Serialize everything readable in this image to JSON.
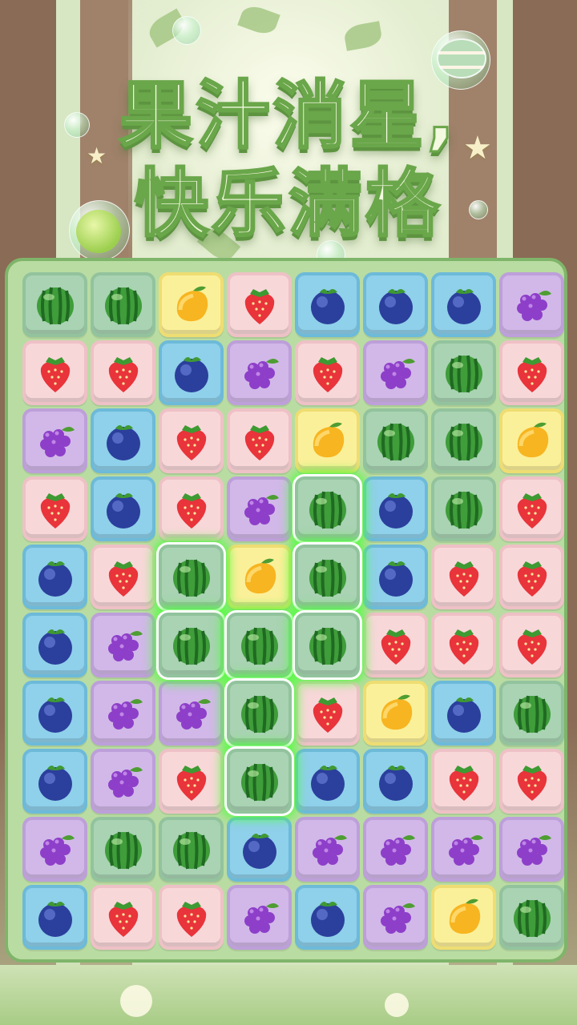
{
  "title": {
    "line1": "果汁消星,",
    "line2": "快乐满格"
  },
  "board": {
    "columns": 8,
    "rows": [
      [
        {
          "fruit": "watermelon",
          "highlighted": false
        },
        {
          "fruit": "watermelon",
          "highlighted": false
        },
        {
          "fruit": "mango",
          "highlighted": false
        },
        {
          "fruit": "strawberry",
          "highlighted": false
        },
        {
          "fruit": "blueberry",
          "highlighted": false
        },
        {
          "fruit": "blueberry",
          "highlighted": false
        },
        {
          "fruit": "blueberry",
          "highlighted": false
        },
        {
          "fruit": "grape",
          "highlighted": false
        }
      ],
      [
        {
          "fruit": "strawberry",
          "highlighted": false
        },
        {
          "fruit": "strawberry",
          "highlighted": false
        },
        {
          "fruit": "blueberry",
          "highlighted": false
        },
        {
          "fruit": "grape",
          "highlighted": false
        },
        {
          "fruit": "strawberry",
          "highlighted": false
        },
        {
          "fruit": "grape",
          "highlighted": false
        },
        {
          "fruit": "watermelon",
          "highlighted": false
        },
        {
          "fruit": "strawberry",
          "highlighted": false
        }
      ],
      [
        {
          "fruit": "grape",
          "highlighted": false
        },
        {
          "fruit": "blueberry",
          "highlighted": false
        },
        {
          "fruit": "strawberry",
          "highlighted": false
        },
        {
          "fruit": "strawberry",
          "highlighted": false
        },
        {
          "fruit": "mango",
          "highlighted": false
        },
        {
          "fruit": "watermelon",
          "highlighted": false
        },
        {
          "fruit": "watermelon",
          "highlighted": false
        },
        {
          "fruit": "mango",
          "highlighted": false
        }
      ],
      [
        {
          "fruit": "strawberry",
          "highlighted": false
        },
        {
          "fruit": "blueberry",
          "highlighted": false
        },
        {
          "fruit": "strawberry",
          "highlighted": false
        },
        {
          "fruit": "grape",
          "highlighted": false
        },
        {
          "fruit": "watermelon",
          "highlighted": true
        },
        {
          "fruit": "blueberry",
          "highlighted": false
        },
        {
          "fruit": "watermelon",
          "highlighted": false
        },
        {
          "fruit": "strawberry",
          "highlighted": false
        }
      ],
      [
        {
          "fruit": "blueberry",
          "highlighted": false
        },
        {
          "fruit": "strawberry",
          "highlighted": false
        },
        {
          "fruit": "watermelon",
          "highlighted": true
        },
        {
          "fruit": "mango",
          "highlighted": false
        },
        {
          "fruit": "watermelon",
          "highlighted": true
        },
        {
          "fruit": "blueberry",
          "highlighted": false
        },
        {
          "fruit": "strawberry",
          "highlighted": false
        },
        {
          "fruit": "strawberry",
          "highlighted": false
        }
      ],
      [
        {
          "fruit": "blueberry",
          "highlighted": false
        },
        {
          "fruit": "grape",
          "highlighted": false
        },
        {
          "fruit": "watermelon",
          "highlighted": true
        },
        {
          "fruit": "watermelon",
          "highlighted": true
        },
        {
          "fruit": "watermelon",
          "highlighted": true
        },
        {
          "fruit": "strawberry",
          "highlighted": false
        },
        {
          "fruit": "strawberry",
          "highlighted": false
        },
        {
          "fruit": "strawberry",
          "highlighted": false
        }
      ],
      [
        {
          "fruit": "blueberry",
          "highlighted": false
        },
        {
          "fruit": "grape",
          "highlighted": false
        },
        {
          "fruit": "grape",
          "highlighted": false
        },
        {
          "fruit": "watermelon",
          "highlighted": true
        },
        {
          "fruit": "strawberry",
          "highlighted": false
        },
        {
          "fruit": "mango",
          "highlighted": false
        },
        {
          "fruit": "blueberry",
          "highlighted": false
        },
        {
          "fruit": "watermelon",
          "highlighted": false
        }
      ],
      [
        {
          "fruit": "blueberry",
          "highlighted": false
        },
        {
          "fruit": "grape",
          "highlighted": false
        },
        {
          "fruit": "strawberry",
          "highlighted": false
        },
        {
          "fruit": "watermelon",
          "highlighted": true
        },
        {
          "fruit": "blueberry",
          "highlighted": false
        },
        {
          "fruit": "blueberry",
          "highlighted": false
        },
        {
          "fruit": "strawberry",
          "highlighted": false
        },
        {
          "fruit": "strawberry",
          "highlighted": false
        }
      ],
      [
        {
          "fruit": "grape",
          "highlighted": false
        },
        {
          "fruit": "watermelon",
          "highlighted": false
        },
        {
          "fruit": "watermelon",
          "highlighted": false
        },
        {
          "fruit": "blueberry",
          "highlighted": false
        },
        {
          "fruit": "grape",
          "highlighted": false
        },
        {
          "fruit": "grape",
          "highlighted": false
        },
        {
          "fruit": "grape",
          "highlighted": false
        },
        {
          "fruit": "grape",
          "highlighted": false
        }
      ],
      [
        {
          "fruit": "blueberry",
          "highlighted": false
        },
        {
          "fruit": "strawberry",
          "highlighted": false
        },
        {
          "fruit": "strawberry",
          "highlighted": false
        },
        {
          "fruit": "grape",
          "highlighted": false
        },
        {
          "fruit": "blueberry",
          "highlighted": false
        },
        {
          "fruit": "grape",
          "highlighted": false
        },
        {
          "fruit": "mango",
          "highlighted": false
        },
        {
          "fruit": "watermelon",
          "highlighted": false
        }
      ]
    ]
  },
  "colors": {
    "highlight_glow": "#4dff3a",
    "board_bg": "#b9dca2",
    "title_text": "#f3fadf",
    "title_stroke": "#6aa64a"
  }
}
